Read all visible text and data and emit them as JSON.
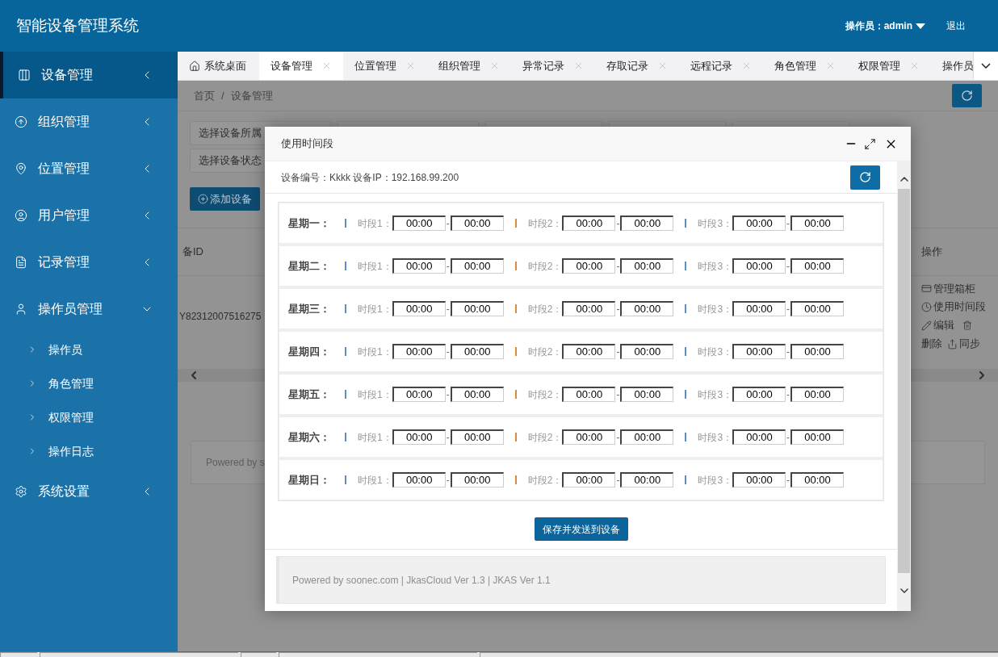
{
  "header": {
    "title": "智能设备管理系统",
    "operator": "操作员：admin",
    "logout": "退出"
  },
  "sidebar": {
    "items": [
      {
        "label": "设备管理",
        "selected": true,
        "expanded": false
      },
      {
        "label": "组织管理",
        "selected": false,
        "expanded": false
      },
      {
        "label": "位置管理",
        "selected": false,
        "expanded": false
      },
      {
        "label": "用户管理",
        "selected": false,
        "expanded": false
      },
      {
        "label": "记录管理",
        "selected": false,
        "expanded": false
      },
      {
        "label": "操作员管理",
        "selected": false,
        "expanded": true,
        "children": [
          {
            "label": "操作员"
          },
          {
            "label": "角色管理"
          },
          {
            "label": "权限管理"
          },
          {
            "label": "操作日志"
          }
        ]
      },
      {
        "label": "系统设置",
        "selected": false,
        "expanded": false
      }
    ]
  },
  "tabs": [
    {
      "label": "系统桌面",
      "kind": "home",
      "selected": false,
      "closable": false
    },
    {
      "label": "设备管理",
      "kind": "page",
      "selected": true,
      "closable": true
    },
    {
      "label": "位置管理",
      "kind": "page",
      "selected": false,
      "closable": true
    },
    {
      "label": "组织管理",
      "kind": "page",
      "selected": false,
      "closable": true
    },
    {
      "label": "异常记录",
      "kind": "page",
      "selected": false,
      "closable": true
    },
    {
      "label": "存取记录",
      "kind": "page",
      "selected": false,
      "closable": true
    },
    {
      "label": "远程记录",
      "kind": "page",
      "selected": false,
      "closable": true
    },
    {
      "label": "角色管理",
      "kind": "page",
      "selected": false,
      "closable": true
    },
    {
      "label": "权限管理",
      "kind": "page",
      "selected": false,
      "closable": true
    },
    {
      "label": "操作员",
      "kind": "page",
      "selected": false,
      "closable": false
    }
  ],
  "breadcrumb": [
    "首页",
    "/",
    "设备管理"
  ],
  "filters": {
    "group_select": "选择设备所属",
    "status_select": "选择设备状态"
  },
  "add_button": "添加设备",
  "table": {
    "columns": [
      "备ID",
      "操作"
    ],
    "rows": [
      {
        "device_id": "Y82312007516275",
        "actions": [
          "管理箱柜",
          "使用时间段",
          "编辑",
          "删除",
          "同步"
        ]
      }
    ]
  },
  "page_footer": "Powered by s",
  "dialog": {
    "title": "使用时间段",
    "info": "设备编号：Kkkk 设备IP：192.168.99.200",
    "days": [
      {
        "label": "星期一：",
        "periods": [
          {
            "color": "#5b8fc4",
            "label": "时段1：",
            "start": "00:00",
            "dash": "-",
            "end": "00:00"
          },
          {
            "color": "#d98c3f",
            "label": "时段2：",
            "start": "00:00",
            "dash": "-",
            "end": "00:00"
          },
          {
            "color": "#5b8fc4",
            "label": "时段3：",
            "start": "00:00",
            "dash": "-",
            "end": "00:00"
          }
        ]
      },
      {
        "label": "星期二：",
        "periods": [
          {
            "color": "#5b8fc4",
            "label": "时段1：",
            "start": "00:00",
            "dash": "-",
            "end": "00:00"
          },
          {
            "color": "#d98c3f",
            "label": "时段2：",
            "start": "00:00",
            "dash": "-",
            "end": "00:00"
          },
          {
            "color": "#5b8fc4",
            "label": "时段3：",
            "start": "00:00",
            "dash": "-",
            "end": "00:00"
          }
        ]
      },
      {
        "label": "星期三：",
        "periods": [
          {
            "color": "#5b8fc4",
            "label": "时段1：",
            "start": "00:00",
            "dash": "-",
            "end": "00:00"
          },
          {
            "color": "#d98c3f",
            "label": "时段2：",
            "start": "00:00",
            "dash": "-",
            "end": "00:00"
          },
          {
            "color": "#5b8fc4",
            "label": "时段3：",
            "start": "00:00",
            "dash": "-",
            "end": "00:00"
          }
        ]
      },
      {
        "label": "星期四：",
        "periods": [
          {
            "color": "#5b8fc4",
            "label": "时段1：",
            "start": "00:00",
            "dash": "-",
            "end": "00:00"
          },
          {
            "color": "#d98c3f",
            "label": "时段2：",
            "start": "00:00",
            "dash": "-",
            "end": "00:00"
          },
          {
            "color": "#5b8fc4",
            "label": "时段3：",
            "start": "00:00",
            "dash": "-",
            "end": "00:00"
          }
        ]
      },
      {
        "label": "星期五：",
        "periods": [
          {
            "color": "#5b8fc4",
            "label": "时段1：",
            "start": "00:00",
            "dash": "-",
            "end": "00:00"
          },
          {
            "color": "#d98c3f",
            "label": "时段2：",
            "start": "00:00",
            "dash": "-",
            "end": "00:00"
          },
          {
            "color": "#5b8fc4",
            "label": "时段3：",
            "start": "00:00",
            "dash": "-",
            "end": "00:00"
          }
        ]
      },
      {
        "label": "星期六：",
        "periods": [
          {
            "color": "#5b8fc4",
            "label": "时段1：",
            "start": "00:00",
            "dash": "-",
            "end": "00:00"
          },
          {
            "color": "#d98c3f",
            "label": "时段2：",
            "start": "00:00",
            "dash": "-",
            "end": "00:00"
          },
          {
            "color": "#5b8fc4",
            "label": "时段3：",
            "start": "00:00",
            "dash": "-",
            "end": "00:00"
          }
        ]
      },
      {
        "label": "星期日：",
        "periods": [
          {
            "color": "#5b8fc4",
            "label": "时段1：",
            "start": "00:00",
            "dash": "-",
            "end": "00:00"
          },
          {
            "color": "#d98c3f",
            "label": "时段2：",
            "start": "00:00",
            "dash": "-",
            "end": "00:00"
          },
          {
            "color": "#5b8fc4",
            "label": "时段3：",
            "start": "00:00",
            "dash": "-",
            "end": "00:00"
          }
        ]
      }
    ],
    "save_button": "保存并发送到设备",
    "footer": "Powered by soonec.com | JkasCloud Ver 1.3 | JKAS Ver 1.1"
  }
}
